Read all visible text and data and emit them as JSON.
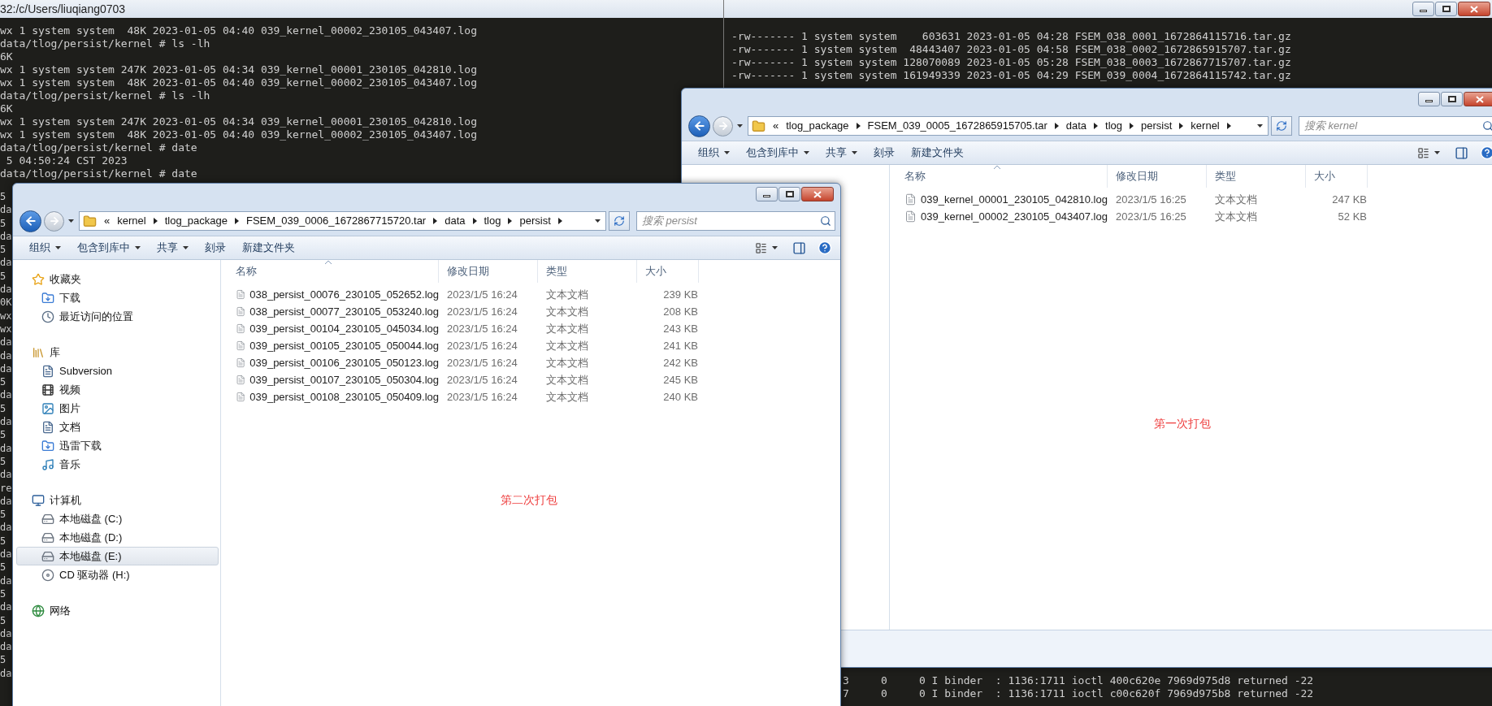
{
  "terminal_left": {
    "title": "32:/c/Users/liuqiang0703",
    "lines": [
      "wx 1 system system  48K 2023-01-05 04:40 039_kernel_00002_230105_043407.log",
      "data/tlog/persist/kernel # ls -lh",
      "6K",
      "wx 1 system system 247K 2023-01-05 04:34 039_kernel_00001_230105_042810.log",
      "wx 1 system system  48K 2023-01-05 04:40 039_kernel_00002_230105_043407.log",
      "data/tlog/persist/kernel # ls -lh",
      "6K",
      "wx 1 system system 247K 2023-01-05 04:34 039_kernel_00001_230105_042810.log",
      "wx 1 system system  48K 2023-01-05 04:40 039_kernel_00002_230105_043407.log",
      "data/tlog/persist/kernel # date",
      " 5 04:50:24 CST 2023",
      "data/tlog/persist/kernel # date"
    ],
    "edge_fragments": [
      "5",
      "da",
      "5",
      "da",
      "5",
      "da",
      "5",
      "da",
      "0K",
      "wx",
      "wx",
      "da",
      "da",
      "da",
      "5",
      "da",
      "5",
      "da",
      "5",
      "da",
      "5",
      "da",
      "re",
      "da",
      "5",
      "da",
      "5",
      "da",
      "5",
      "da",
      "5",
      "da",
      "5",
      "da",
      "da",
      "5",
      "da"
    ]
  },
  "terminal_right": {
    "lines": [
      "-rw------- 1 system system    603631 2023-01-05 04:28 FSEM_038_0001_1672864115716.tar.gz",
      "-rw------- 1 system system  48443407 2023-01-05 04:58 FSEM_038_0002_1672865915707.tar.gz",
      "-rw------- 1 system system 128070089 2023-01-05 05:28 FSEM_038_0003_1672867715707.tar.gz",
      "-rw------- 1 system system 161949339 2023-01-05 04:29 FSEM_039_0004_1672864115742.tar.gz"
    ],
    "bottom_lines": [
      "3     0     0 I binder  : 1136:1711 ioctl 400c620e 7969d975d8 returned -22",
      "7     0     0 I binder  : 1136:1711 ioctl c00c620f 7969d975b8 returned -22"
    ]
  },
  "explorer_back": {
    "overflow_mark": "«",
    "breadcrumb": [
      "tlog_package",
      "FSEM_039_0005_1672865915705.tar",
      "data",
      "tlog",
      "persist",
      "kernel"
    ],
    "search": {
      "placeholder": "搜索 kernel"
    },
    "toolbar": [
      {
        "label": "组织",
        "menu": true
      },
      {
        "label": "包含到库中",
        "menu": true
      },
      {
        "label": "共享",
        "menu": true
      },
      {
        "label": "刻录",
        "menu": false
      },
      {
        "label": "新建文件夹",
        "menu": false
      }
    ],
    "columns": [
      "名称",
      "修改日期",
      "类型",
      "大小"
    ],
    "files": [
      {
        "name": "039_kernel_00001_230105_042810.log",
        "modified": "2023/1/5 16:25",
        "type": "文本文档",
        "size": "247 KB"
      },
      {
        "name": "039_kernel_00002_230105_043407.log",
        "modified": "2023/1/5 16:25",
        "type": "文本文档",
        "size": "52 KB"
      }
    ],
    "note": "第一次打包"
  },
  "explorer_front": {
    "overflow_mark": "«",
    "breadcrumb": [
      "kernel",
      "tlog_package",
      "FSEM_039_0006_1672867715720.tar",
      "data",
      "tlog",
      "persist"
    ],
    "search": {
      "placeholder": "搜索 persist"
    },
    "toolbar": [
      {
        "label": "组织",
        "menu": true
      },
      {
        "label": "包含到库中",
        "menu": true
      },
      {
        "label": "共享",
        "menu": true
      },
      {
        "label": "刻录",
        "menu": false
      },
      {
        "label": "新建文件夹",
        "menu": false
      }
    ],
    "nav": [
      {
        "label": "收藏夹",
        "kind": "favorites",
        "selected": false,
        "children": [
          {
            "label": "下载",
            "kind": "download",
            "selected": false
          },
          {
            "label": "最近访问的位置",
            "kind": "recent",
            "selected": false
          }
        ]
      },
      {
        "label": "库",
        "kind": "library",
        "selected": false,
        "children": [
          {
            "label": "Subversion",
            "kind": "document",
            "selected": false
          },
          {
            "label": "视频",
            "kind": "video",
            "selected": false
          },
          {
            "label": "图片",
            "kind": "picture",
            "selected": false
          },
          {
            "label": "文档",
            "kind": "document",
            "selected": false
          },
          {
            "label": "迅雷下载",
            "kind": "download",
            "selected": false
          },
          {
            "label": "音乐",
            "kind": "music",
            "selected": false
          }
        ]
      },
      {
        "label": "计算机",
        "kind": "computer",
        "selected": false,
        "children": [
          {
            "label": "本地磁盘 (C:)",
            "kind": "drive",
            "selected": false
          },
          {
            "label": "本地磁盘 (D:)",
            "kind": "drive",
            "selected": false
          },
          {
            "label": "本地磁盘 (E:)",
            "kind": "drive",
            "selected": true
          },
          {
            "label": "CD 驱动器 (H:)",
            "kind": "cd",
            "selected": false
          }
        ]
      },
      {
        "label": "网络",
        "kind": "network",
        "selected": false
      }
    ],
    "columns": [
      "名称",
      "修改日期",
      "类型",
      "大小"
    ],
    "files": [
      {
        "name": "038_persist_00076_230105_052652.log",
        "modified": "2023/1/5 16:24",
        "type": "文本文档",
        "size": "239 KB"
      },
      {
        "name": "038_persist_00077_230105_053240.log",
        "modified": "2023/1/5 16:24",
        "type": "文本文档",
        "size": "208 KB"
      },
      {
        "name": "039_persist_00104_230105_045034.log",
        "modified": "2023/1/5 16:24",
        "type": "文本文档",
        "size": "243 KB"
      },
      {
        "name": "039_persist_00105_230105_050044.log",
        "modified": "2023/1/5 16:24",
        "type": "文本文档",
        "size": "241 KB"
      },
      {
        "name": "039_persist_00106_230105_050123.log",
        "modified": "2023/1/5 16:24",
        "type": "文本文档",
        "size": "242 KB"
      },
      {
        "name": "039_persist_00107_230105_050304.log",
        "modified": "2023/1/5 16:24",
        "type": "文本文档",
        "size": "245 KB"
      },
      {
        "name": "039_persist_00108_230105_050409.log",
        "modified": "2023/1/5 16:24",
        "type": "文本文档",
        "size": "240 KB"
      }
    ],
    "note": "第二次打包"
  }
}
